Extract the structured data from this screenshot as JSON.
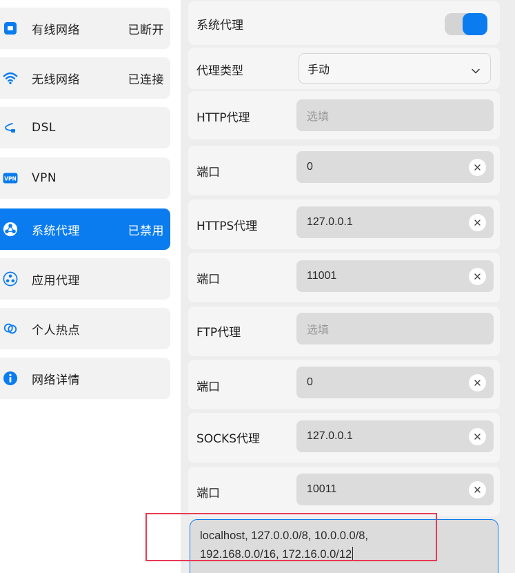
{
  "sidebar": {
    "items": [
      {
        "label": "有线网络",
        "status": "已断开",
        "icon": "wired-network-icon"
      },
      {
        "label": "无线网络",
        "status": "已连接",
        "icon": "wifi-icon"
      },
      {
        "label": "DSL",
        "status": "",
        "icon": "dsl-cable-icon"
      },
      {
        "label": "VPN",
        "status": "",
        "icon": "vpn-icon"
      },
      {
        "label": "系统代理",
        "status": "已禁用",
        "icon": "system-proxy-icon",
        "active": true
      },
      {
        "label": "应用代理",
        "status": "",
        "icon": "app-proxy-icon"
      },
      {
        "label": "个人热点",
        "status": "",
        "icon": "hotspot-icon"
      },
      {
        "label": "网络详情",
        "status": "",
        "icon": "info-icon"
      }
    ]
  },
  "proxy": {
    "system_proxy_label": "系统代理",
    "system_proxy_enabled": true,
    "type_label": "代理类型",
    "type_value": "手动",
    "http_label": "HTTP代理",
    "http_placeholder": "选填",
    "http_port_label": "端口",
    "http_port_value": "0",
    "https_label": "HTTPS代理",
    "https_value": "127.0.0.1",
    "https_port_label": "端口",
    "https_port_value": "11001",
    "ftp_label": "FTP代理",
    "ftp_placeholder": "选填",
    "ftp_port_label": "端口",
    "ftp_port_value": "0",
    "socks_label": "SOCKS代理",
    "socks_value": "127.0.0.1",
    "socks_port_label": "端口",
    "socks_port_value": "10011",
    "ignore_hosts_line1": "localhost, 127.0.0.0/8, 10.0.0.0/8,",
    "ignore_hosts_line2": "192.168.0.0/16, 172.16.0.0/12"
  },
  "colors": {
    "accent": "#0a7cf0",
    "annotation": "#e83a55"
  }
}
